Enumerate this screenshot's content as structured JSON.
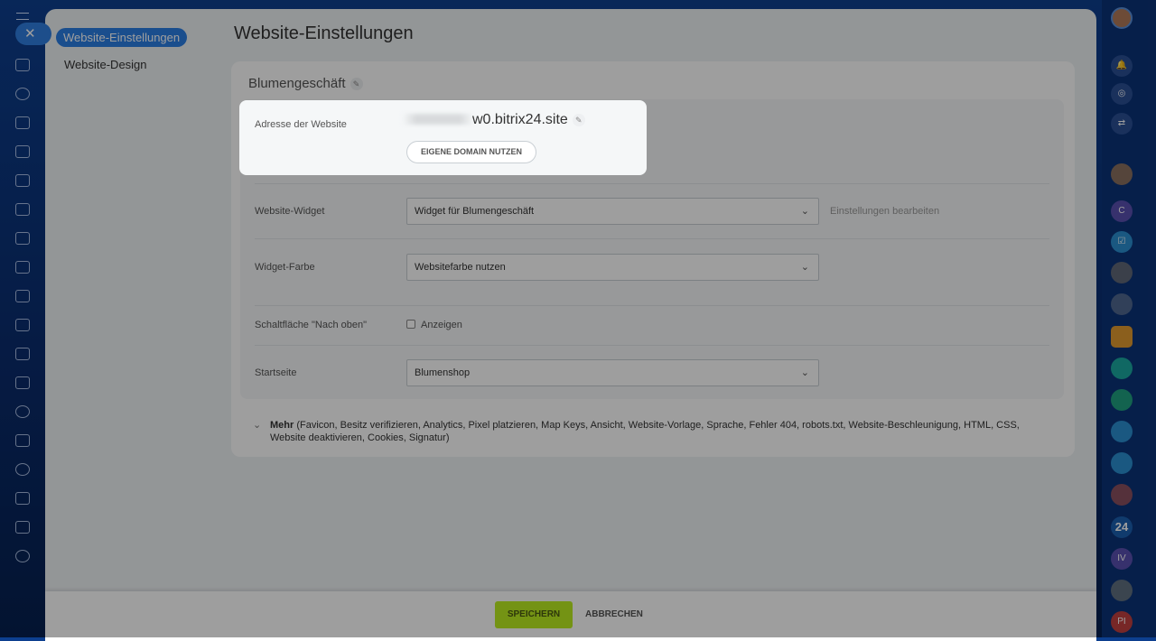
{
  "nav": {
    "items": [
      {
        "label": "Website-Einstellungen",
        "active": true
      },
      {
        "label": "Website-Design"
      }
    ]
  },
  "page_title": "Website-Einstellungen",
  "site_name": "Blumengeschäft",
  "address": {
    "label": "Adresse der Website",
    "value": "w0.bitrix24.site",
    "domain_button": "EIGENE DOMAIN NUTZEN"
  },
  "widget": {
    "label": "Website-Widget",
    "value": "Widget für Blumengeschäft",
    "link": "Einstellungen bearbeiten"
  },
  "widget_color": {
    "label": "Widget-Farbe",
    "value": "Websitefarbe nutzen"
  },
  "scroll_top": {
    "label": "Schaltfläche \"Nach oben\"",
    "checkbox_label": "Anzeigen",
    "checked": false
  },
  "start_page": {
    "label": "Startseite",
    "value": "Blumenshop"
  },
  "more": {
    "label": "Mehr",
    "items": "(Favicon, Besitz verifizieren, Analytics, Pixel platzieren, Map Keys, Ansicht, Website-Vorlage, Sprache, Fehler 404, robots.txt, Website-Beschleunigung, HTML, CSS, Website deaktivieren, Cookies, Signatur)"
  },
  "footer": {
    "save": "SPEICHERN",
    "cancel": "ABBRECHEN"
  },
  "rightbar": {
    "badges": [
      "C",
      "24",
      "IV",
      "PI"
    ]
  },
  "colors": {
    "accent": "#2a7ee4",
    "save": "#bbed21"
  }
}
